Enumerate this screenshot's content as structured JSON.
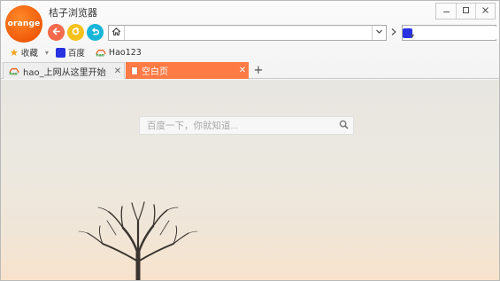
{
  "app": {
    "logo_text": "orange",
    "title": "桔子浏览器",
    "accent_color": "#ff7b45"
  },
  "window_controls": {
    "minimize_icon": "minimize-icon",
    "maximize_icon": "maximize-icon",
    "close_icon": "close-icon"
  },
  "toolbar": {
    "back_icon": "back-arrow-icon",
    "refresh_icon": "refresh-icon",
    "undo_icon": "undo-icon",
    "home_icon": "home-icon",
    "address_value": "",
    "go_icon": "chevron-right-icon",
    "search_engine_icon": "baidu-paw-icon",
    "search_value": ""
  },
  "bookmarks": {
    "items": [
      {
        "label": "收藏",
        "icon": "star-icon"
      },
      {
        "label": "百度",
        "icon": "baidu-paw-icon"
      },
      {
        "label": "Hao123",
        "icon": "hao-icon"
      }
    ]
  },
  "tabs": {
    "items": [
      {
        "title": "hao_上网从这里开始",
        "icon": "hao-icon",
        "active": false
      },
      {
        "title": "空白页",
        "icon": "page-icon",
        "active": true
      }
    ],
    "new_tab_icon": "plus-icon"
  },
  "page": {
    "search_placeholder": "百度一下，你就知道...",
    "search_icon": "search-icon"
  }
}
